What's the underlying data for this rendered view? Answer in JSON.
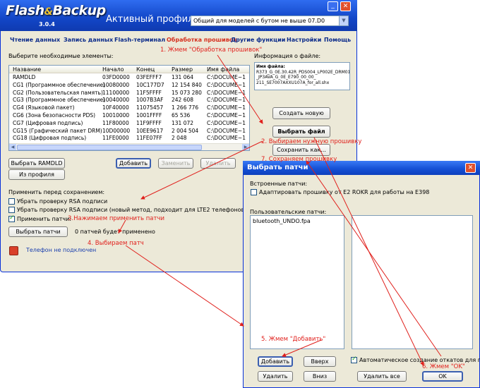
{
  "main": {
    "logo": {
      "brand1": "Flash",
      "brand2": "Backup",
      "version": "3.0.4"
    },
    "profile_label": "Активный профиль:",
    "profile_value": "Общий для моделей с бутом не выше 07.D0",
    "tabs": [
      "Чтение данных",
      "Запись данных",
      "Flash-терминал",
      "Обработка прошивок",
      "Другие функции",
      "Настройки",
      "Помощь"
    ],
    "active_tab": 3,
    "select_label": "Выберите необходимые элементы:",
    "info_label": "Информация о файле:",
    "info_text": [
      "Имя файла:",
      "R373_G_0E.30.42R_PDS004_LP002E_DRM0101",
      "_JP3AVA_G_0E_E790_00_00_",
      "211_SE7007AXXU107A_for_all.shx"
    ],
    "table": {
      "headers": [
        "Название",
        "Начало",
        "Конец",
        "Размер",
        "Имя файла"
      ],
      "rows": [
        [
          "RAMDLD",
          "03FD0000",
          "03FEFFF7",
          "131 064",
          "C:\\DOCUME~1"
        ],
        [
          "CG1 (Программное обеспечение)",
          "10080000",
          "10C177D7",
          "12 154 840",
          "C:\\DOCUME~1"
        ],
        [
          "CG2 (Пользовательская память)",
          "11100000",
          "11F5FFFF",
          "15 073 280",
          "C:\\DOCUME~1"
        ],
        [
          "CG3 (Программное обеспечение)",
          "10040000",
          "1007B3AF",
          "242 608",
          "C:\\DOCUME~1"
        ],
        [
          "CG4 (Языковой пакет)",
          "10F40000",
          "11075457",
          "1 266 776",
          "C:\\DOCUME~1"
        ],
        [
          "CG6 (Зона безопасности PDS)",
          "10010000",
          "1001FFFF",
          "65 536",
          "C:\\DOCUME~1"
        ],
        [
          "CG7 (Цифровая подпись)",
          "11F80000",
          "11F9FFFF",
          "131 072",
          "C:\\DOCUME~1"
        ],
        [
          "CG15 (Графический пакет DRM)",
          "10D00000",
          "10EE9617",
          "2 004 504",
          "C:\\DOCUME~1"
        ],
        [
          "CG18 (Цифровая подпись)",
          "11FE0000",
          "11FE07FF",
          "2 048",
          "C:\\DOCUME~1"
        ]
      ]
    },
    "buttons": {
      "select_ramdld": "Выбрать RAMDLD",
      "from_profile": "Из профиля",
      "add": "Добавить",
      "replace": "Заменить",
      "delete": "Удалить",
      "create_new": "Создать новую",
      "select_file": "Выбрать файл",
      "save_as": "Сохранить как...",
      "select_patches": "Выбрать патчи"
    },
    "apply_label": "Применить перед сохранением:",
    "checks": [
      {
        "label": "Убрать проверку RSA подписи",
        "checked": false
      },
      {
        "label": "Убрать проверку RSA подписи (новый метод, подходит для LTE2 телефонов)",
        "checked": false
      },
      {
        "label": "Применить патчи:",
        "checked": true
      }
    ],
    "patches_status": "0 патчей будет применено",
    "phone_status": "Телефон не подключен",
    "colors": {
      "title_bar": "#1f55d3",
      "accent": "#e0201c"
    }
  },
  "dialog": {
    "title": "Выбрать патчи",
    "builtin_label": "Встроенные патчи:",
    "builtin_check": "Адаптировать прошивку от E2 ROKR для работы на E398",
    "user_label": "Пользовательские патчи:",
    "items": [
      "bluetooth_UNDO.fpa"
    ],
    "buttons": {
      "add": "Добавить",
      "up": "Вверх",
      "delete": "Удалить",
      "down": "Вниз",
      "delete_all": "Удалить все",
      "ok": "OK"
    },
    "auto_check": "Автоматическое создание откатов для патчей"
  },
  "annotations": {
    "a1": "1. Жмем \"Обработка прошивок\"",
    "a2": "2. Выбираем нужную прошивку",
    "a3": "3.Нажимаем применить патчи",
    "a4": "4. Выбираем патч",
    "a5": "5. Жмем \"Добавить\"",
    "a6": "6. Жмем \"OK\"",
    "a7": "7. Сохраняем прошивку"
  }
}
